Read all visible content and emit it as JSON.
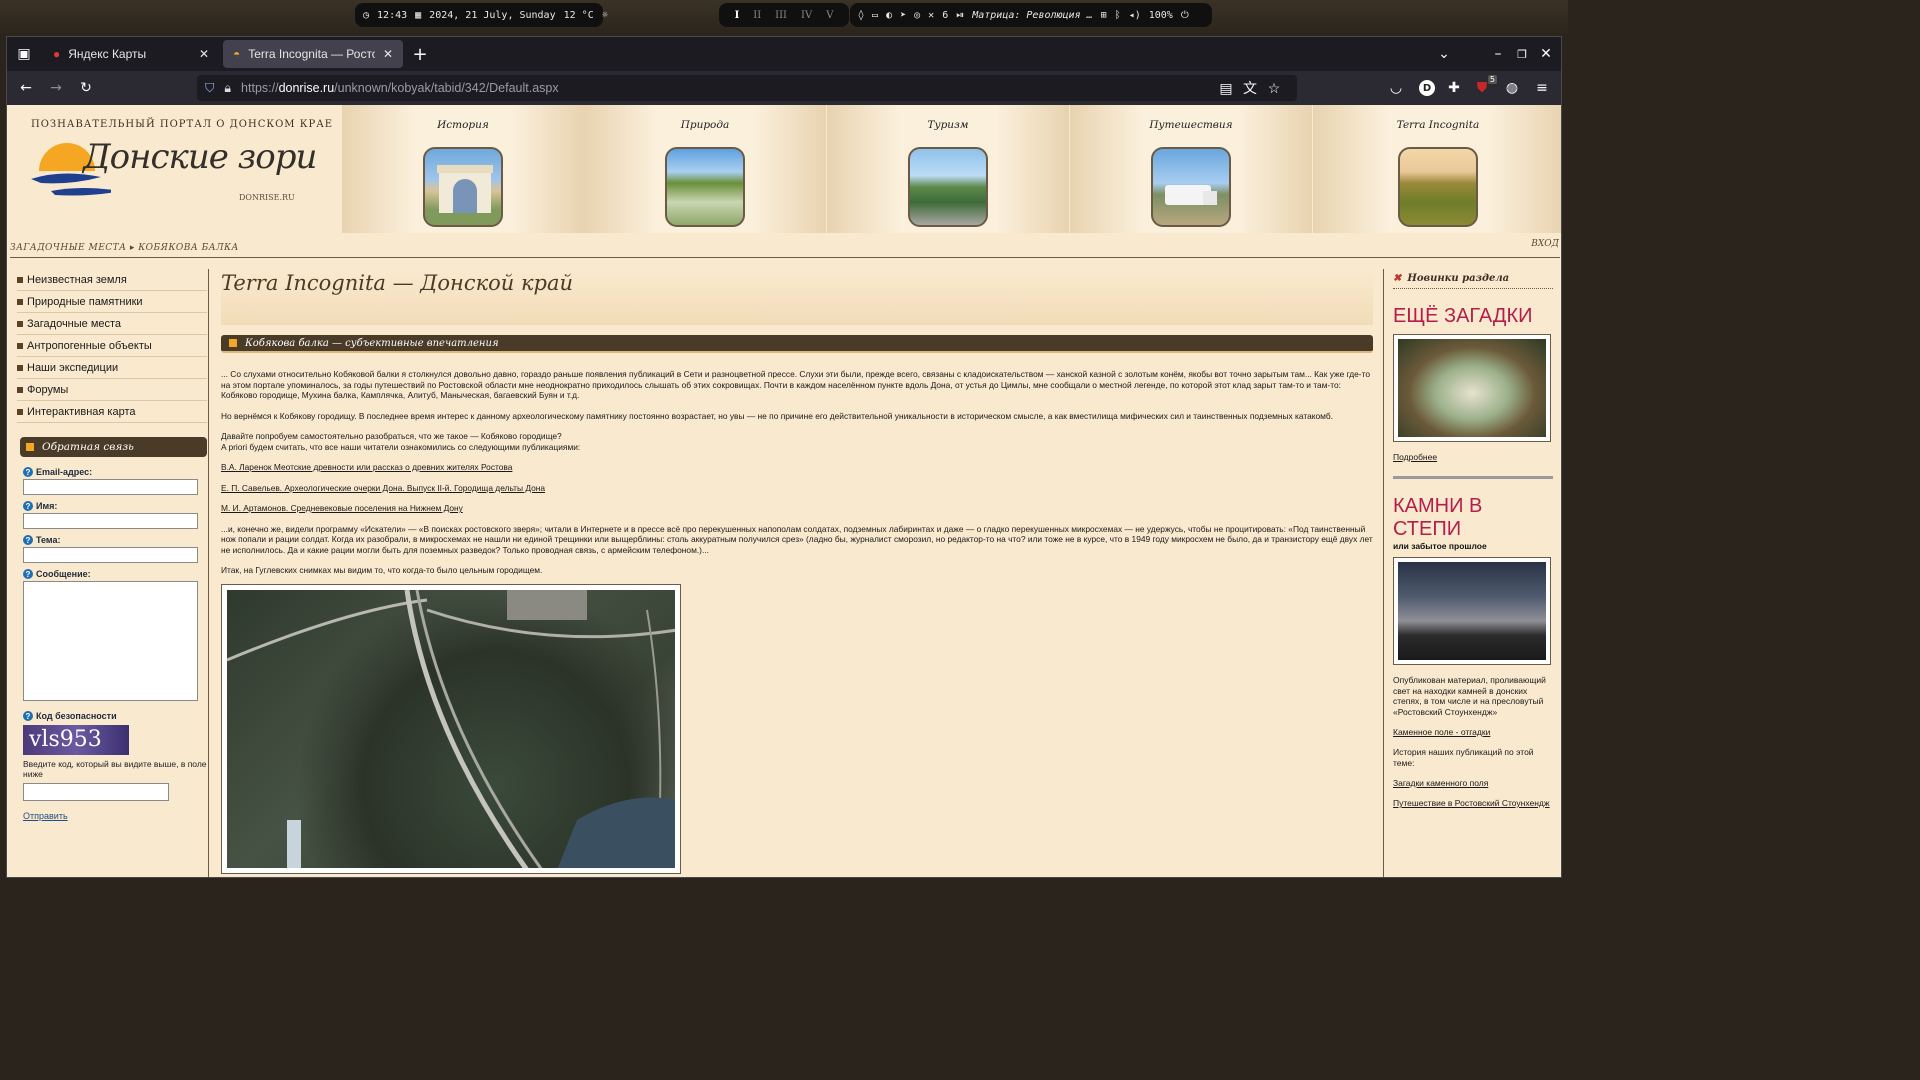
{
  "desktop": {
    "clock": "12:43",
    "date": "2024, 21 July, Sunday",
    "temp": "12 °C",
    "workspaces": [
      "I",
      "II",
      "III",
      "IV",
      "V"
    ],
    "notif_count": "6",
    "media": "Матрица: Революция …",
    "volume": "100%"
  },
  "browser": {
    "tabs": [
      {
        "label": "Яндекс Карты"
      },
      {
        "label": "Terra Incognita — Ростовс"
      }
    ],
    "url_prefix": "https://",
    "url_domain": "donrise.ru",
    "url_path": "/unknown/kobyak/tabid/342/Default.aspx",
    "ublock_count": "5",
    "profile_letter": "D"
  },
  "header": {
    "tagline": "ПОЗНАВАТЕЛЬНЫЙ ПОРТАЛ О ДОНСКОМ КРАЕ",
    "logo": "Донские зори",
    "site": "DONRISE.RU",
    "nav": [
      "История",
      "Природа",
      "Туризм",
      "Путешествия",
      "Terra Incognita"
    ],
    "breadcrumb": "ЗАГАДОЧНЫЕ МЕСТА ▸ КОБЯКОВА БАЛКА",
    "login": "ВХОД"
  },
  "left": {
    "menu": [
      "Неизвестная земля",
      "Природные памятники",
      "Загадочные места",
      "Антропогенные объекты",
      "Наши экспедиции",
      "Форумы",
      "Интерактивная карта"
    ],
    "feedback_title": "Обратная связь",
    "email_label": "Email-адрес:",
    "name_label": "Имя:",
    "topic_label": "Тема:",
    "message_label": "Сообщение:",
    "captcha_label": "Код безопасности",
    "captcha_text": "vls953",
    "captcha_hint": "Введите код, который вы видите выше, в поле ниже",
    "submit": "Отправить"
  },
  "main": {
    "title": "Terra Incognita — Донской край",
    "section": "Кобякова балка — субъективные впечатления",
    "p1": "... Со слухами относительно Кобяковой балки я столкнулся довольно давно, гораздо раньше появления публикаций в Сети и разноцветной прессе. Слухи эти были, прежде всего, связаны с кладоискательством — ханской казной с золотым конём, якобы вот точно зарытым там... Как уже где-то на этом портале упоминалось, за годы путешествий по Ростовской области мне неоднократно приходилось слышать об этих сокровищах. Почти в каждом населённом пункте вдоль Дона, от устья до Цимлы, мне сообщали о местной легенде, по которой этот клад зарыт там-то и там-то: Кобяково городище, Мухина балка, Камплячка, Алитуб, Маныческая, багаевский Буян и т.д.",
    "p2": "Но вернёмся к Кобякову городищу. В последнее время интерес к данному археологическому памятнику постоянно возрастает,  но увы — не по причине его действительной уникальности в историческом смысле, а как вместилища мифических сил и таинственных подземных катакомб.",
    "p3a": "Давайте попробуем самостоятельно разобраться, что же такое — Кобяково городище?",
    "p3b": "A priori будем считать, что все наши читатели ознакомились со следующими публикациями:",
    "link1": "В.А. Ларенок Меотские древности или рассказ о древних  жителях Ростова",
    "link2": "Е. П. Савельев. Археологические очерки Дона. Выпуск II-й. Городища дельты Дона",
    "link3": "М. И. Артамонов. Средневековые поселения на Нижнем Дону",
    "p4": "...и, конечно же, видели программу «Искатели» — «В поисках ростовского зверя»; читали в Интернете и в прессе всё про перекушенных напополам солдатах, подземных лабиринтах и даже — о гладко перекушенных микросхемах — не удержусь, чтобы не процитировать: «Под таинственный нож попали и рации солдат. Когда их разобрали, в микросхемах не нашли ни единой трещинки или выщерблины: столь аккуратным получился срез» (ладно бы, журналист сморозил, но редактор-то на что? или тоже не в курсе, что в 1949 году микросхем не было, да и транзистору ещё двух лет не исполнилось. Да и какие рации могли быть для поземных разведок? Только проводная связь, с армейским телефоном.)...",
    "p5": "Итак, на Гуглевских снимках мы видим то, что когда-то было цельным городищем."
  },
  "right": {
    "news_title": "Новинки раздела",
    "item1_title": "ЕЩЁ ЗАГАДКИ",
    "item1_link": "Подробнее",
    "item2_title": "КАМНИ В СТЕПИ",
    "item2_sub": "или забытое прошлое",
    "item2_text": "Опубликован материал, проливающий свет на находки камней в донских степях, в том числе и на пресловутый  «Ростовский Стоунхендж»",
    "item2_link": "Каменное поле - отгадки",
    "history_text": "История наших публикаций по этой теме:",
    "link_a": "Загадки каменного поля",
    "link_b": "Путешествие в Ростовский Стоунхендж"
  }
}
